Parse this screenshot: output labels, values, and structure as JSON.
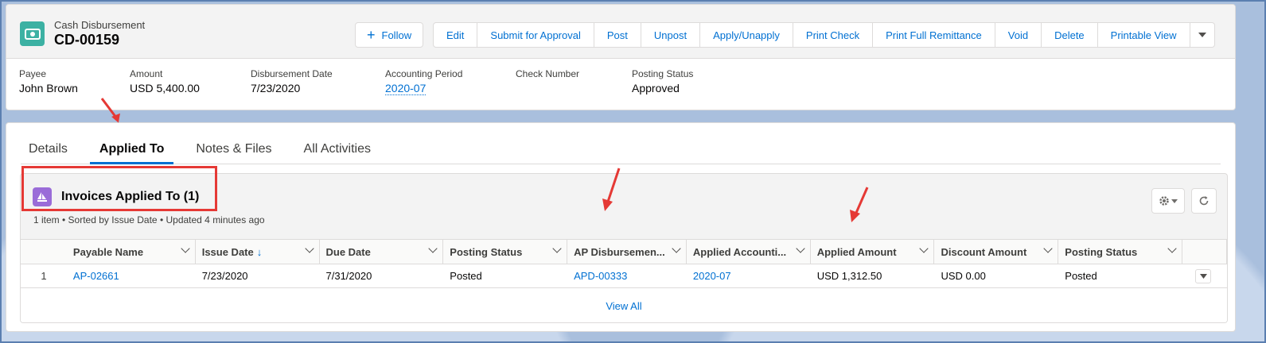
{
  "header": {
    "object_type": "Cash Disbursement",
    "record_name": "CD-00159",
    "follow_label": "Follow",
    "actions": [
      "Edit",
      "Submit for Approval",
      "Post",
      "Unpost",
      "Apply/Unapply",
      "Print Check",
      "Print Full Remittance",
      "Void",
      "Delete",
      "Printable View"
    ]
  },
  "highlights": {
    "payee_label": "Payee",
    "payee_value": "John Brown",
    "amount_label": "Amount",
    "amount_value": "USD 5,400.00",
    "date_label": "Disbursement Date",
    "date_value": "7/23/2020",
    "period_label": "Accounting Period",
    "period_value": "2020-07",
    "check_label": "Check Number",
    "check_value": "",
    "status_label": "Posting Status",
    "status_value": "Approved"
  },
  "tabs": [
    "Details",
    "Applied To",
    "Notes & Files",
    "All Activities"
  ],
  "related_list": {
    "title": "Invoices Applied To (1)",
    "subtitle": "1 item • Sorted by Issue Date • Updated 4 minutes ago",
    "columns": [
      "Payable Name",
      "Issue Date",
      "Due Date",
      "Posting Status",
      "AP Disbursemen...",
      "Applied Accounti...",
      "Applied Amount",
      "Discount Amount",
      "Posting Status"
    ],
    "rows": [
      {
        "num": "1",
        "payable_name": "AP-02661",
        "issue_date": "7/23/2020",
        "due_date": "7/31/2020",
        "posting_status": "Posted",
        "ap_disbursement": "APD-00333",
        "applied_period": "2020-07",
        "applied_amount": "USD 1,312.50",
        "discount_amount": "USD 0.00",
        "posting_status_2": "Posted"
      }
    ],
    "view_all": "View All"
  },
  "colors": {
    "brand": "#0070d2",
    "object_icon": "#3cb1a3",
    "related_icon": "#9a6cd8",
    "annotation": "#e53935"
  },
  "icons": [
    "money-icon",
    "plus-icon",
    "chevron-down-icon",
    "sailboat-icon",
    "gear-icon",
    "refresh-icon",
    "sort-arrow-icon"
  ]
}
